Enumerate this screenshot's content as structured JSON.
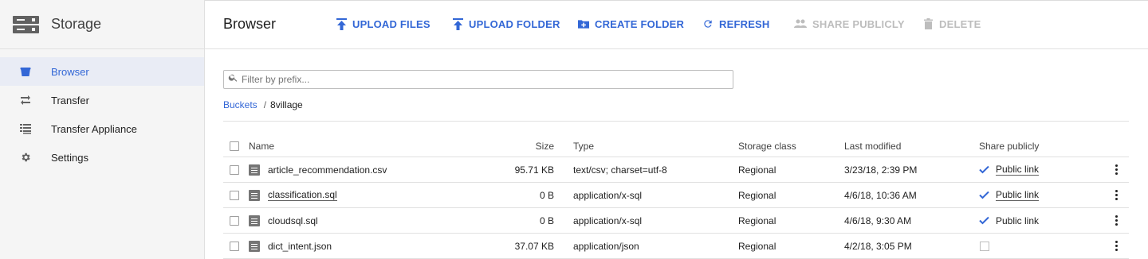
{
  "app": {
    "title": "Storage"
  },
  "sidebar": {
    "items": [
      {
        "label": "Browser",
        "icon": "bucket-icon",
        "active": true
      },
      {
        "label": "Transfer",
        "icon": "transfer-arrows-icon",
        "active": false
      },
      {
        "label": "Transfer Appliance",
        "icon": "list-icon",
        "active": false
      },
      {
        "label": "Settings",
        "icon": "gear-icon",
        "active": false
      }
    ]
  },
  "header": {
    "title": "Browser",
    "actions": {
      "upload_files": "UPLOAD FILES",
      "upload_folder": "UPLOAD FOLDER",
      "create_folder": "CREATE FOLDER",
      "refresh": "REFRESH",
      "share_publicly": "SHARE PUBLICLY",
      "delete": "DELETE"
    }
  },
  "filter": {
    "placeholder": "Filter by prefix...",
    "value": ""
  },
  "breadcrumb": {
    "root": "Buckets",
    "separator": "/",
    "current": "8village"
  },
  "table": {
    "columns": {
      "name": "Name",
      "size": "Size",
      "type": "Type",
      "storage_class": "Storage class",
      "last_modified": "Last modified",
      "share": "Share publicly"
    },
    "rows": [
      {
        "name": "article_recommendation.csv",
        "size": "95.71 KB",
        "type": "text/csv; charset=utf-8",
        "storage_class": "Regional",
        "last_modified": "3/23/18, 2:39 PM",
        "public": true,
        "public_label": "Public link"
      },
      {
        "name": "classification.sql",
        "size": "0 B",
        "type": "application/x-sql",
        "storage_class": "Regional",
        "last_modified": "4/6/18, 10:36 AM",
        "public": true,
        "public_label": "Public link"
      },
      {
        "name": "cloudsql.sql",
        "size": "0 B",
        "type": "application/x-sql",
        "storage_class": "Regional",
        "last_modified": "4/6/18, 9:30 AM",
        "public": true,
        "public_label": "Public link"
      },
      {
        "name": "dict_intent.json",
        "size": "37.07 KB",
        "type": "application/json",
        "storage_class": "Regional",
        "last_modified": "4/2/18, 3:05 PM",
        "public": false,
        "public_label": ""
      }
    ]
  },
  "colors": {
    "accent": "#3367d6",
    "disabled": "#bdbdbd",
    "sidebar_bg": "#f5f5f5",
    "active_bg": "#e9ecf5"
  }
}
